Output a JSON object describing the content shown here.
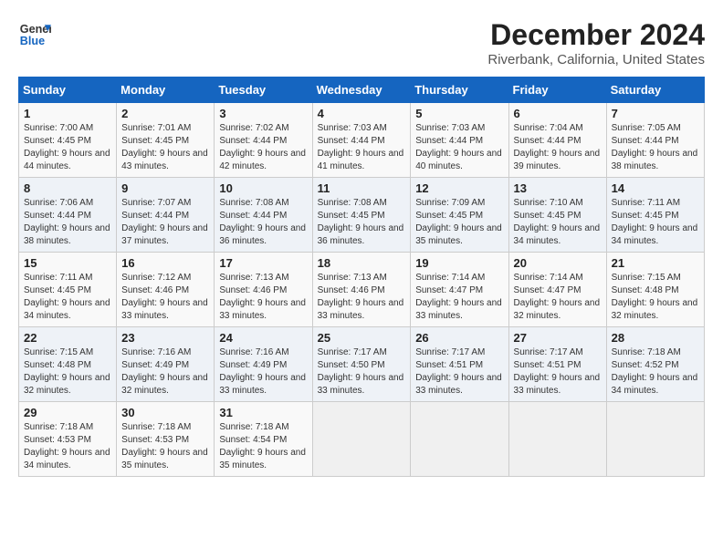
{
  "logo": {
    "line1": "General",
    "line2": "Blue"
  },
  "title": "December 2024",
  "subtitle": "Riverbank, California, United States",
  "headers": [
    "Sunday",
    "Monday",
    "Tuesday",
    "Wednesday",
    "Thursday",
    "Friday",
    "Saturday"
  ],
  "weeks": [
    [
      {
        "day": "1",
        "sunrise": "7:00 AM",
        "sunset": "4:45 PM",
        "daylight": "9 hours and 44 minutes."
      },
      {
        "day": "2",
        "sunrise": "7:01 AM",
        "sunset": "4:45 PM",
        "daylight": "9 hours and 43 minutes."
      },
      {
        "day": "3",
        "sunrise": "7:02 AM",
        "sunset": "4:44 PM",
        "daylight": "9 hours and 42 minutes."
      },
      {
        "day": "4",
        "sunrise": "7:03 AM",
        "sunset": "4:44 PM",
        "daylight": "9 hours and 41 minutes."
      },
      {
        "day": "5",
        "sunrise": "7:03 AM",
        "sunset": "4:44 PM",
        "daylight": "9 hours and 40 minutes."
      },
      {
        "day": "6",
        "sunrise": "7:04 AM",
        "sunset": "4:44 PM",
        "daylight": "9 hours and 39 minutes."
      },
      {
        "day": "7",
        "sunrise": "7:05 AM",
        "sunset": "4:44 PM",
        "daylight": "9 hours and 38 minutes."
      }
    ],
    [
      {
        "day": "8",
        "sunrise": "7:06 AM",
        "sunset": "4:44 PM",
        "daylight": "9 hours and 38 minutes."
      },
      {
        "day": "9",
        "sunrise": "7:07 AM",
        "sunset": "4:44 PM",
        "daylight": "9 hours and 37 minutes."
      },
      {
        "day": "10",
        "sunrise": "7:08 AM",
        "sunset": "4:44 PM",
        "daylight": "9 hours and 36 minutes."
      },
      {
        "day": "11",
        "sunrise": "7:08 AM",
        "sunset": "4:45 PM",
        "daylight": "9 hours and 36 minutes."
      },
      {
        "day": "12",
        "sunrise": "7:09 AM",
        "sunset": "4:45 PM",
        "daylight": "9 hours and 35 minutes."
      },
      {
        "day": "13",
        "sunrise": "7:10 AM",
        "sunset": "4:45 PM",
        "daylight": "9 hours and 34 minutes."
      },
      {
        "day": "14",
        "sunrise": "7:11 AM",
        "sunset": "4:45 PM",
        "daylight": "9 hours and 34 minutes."
      }
    ],
    [
      {
        "day": "15",
        "sunrise": "7:11 AM",
        "sunset": "4:45 PM",
        "daylight": "9 hours and 34 minutes."
      },
      {
        "day": "16",
        "sunrise": "7:12 AM",
        "sunset": "4:46 PM",
        "daylight": "9 hours and 33 minutes."
      },
      {
        "day": "17",
        "sunrise": "7:13 AM",
        "sunset": "4:46 PM",
        "daylight": "9 hours and 33 minutes."
      },
      {
        "day": "18",
        "sunrise": "7:13 AM",
        "sunset": "4:46 PM",
        "daylight": "9 hours and 33 minutes."
      },
      {
        "day": "19",
        "sunrise": "7:14 AM",
        "sunset": "4:47 PM",
        "daylight": "9 hours and 33 minutes."
      },
      {
        "day": "20",
        "sunrise": "7:14 AM",
        "sunset": "4:47 PM",
        "daylight": "9 hours and 32 minutes."
      },
      {
        "day": "21",
        "sunrise": "7:15 AM",
        "sunset": "4:48 PM",
        "daylight": "9 hours and 32 minutes."
      }
    ],
    [
      {
        "day": "22",
        "sunrise": "7:15 AM",
        "sunset": "4:48 PM",
        "daylight": "9 hours and 32 minutes."
      },
      {
        "day": "23",
        "sunrise": "7:16 AM",
        "sunset": "4:49 PM",
        "daylight": "9 hours and 32 minutes."
      },
      {
        "day": "24",
        "sunrise": "7:16 AM",
        "sunset": "4:49 PM",
        "daylight": "9 hours and 33 minutes."
      },
      {
        "day": "25",
        "sunrise": "7:17 AM",
        "sunset": "4:50 PM",
        "daylight": "9 hours and 33 minutes."
      },
      {
        "day": "26",
        "sunrise": "7:17 AM",
        "sunset": "4:51 PM",
        "daylight": "9 hours and 33 minutes."
      },
      {
        "day": "27",
        "sunrise": "7:17 AM",
        "sunset": "4:51 PM",
        "daylight": "9 hours and 33 minutes."
      },
      {
        "day": "28",
        "sunrise": "7:18 AM",
        "sunset": "4:52 PM",
        "daylight": "9 hours and 34 minutes."
      }
    ],
    [
      {
        "day": "29",
        "sunrise": "7:18 AM",
        "sunset": "4:53 PM",
        "daylight": "9 hours and 34 minutes."
      },
      {
        "day": "30",
        "sunrise": "7:18 AM",
        "sunset": "4:53 PM",
        "daylight": "9 hours and 35 minutes."
      },
      {
        "day": "31",
        "sunrise": "7:18 AM",
        "sunset": "4:54 PM",
        "daylight": "9 hours and 35 minutes."
      },
      null,
      null,
      null,
      null
    ]
  ]
}
